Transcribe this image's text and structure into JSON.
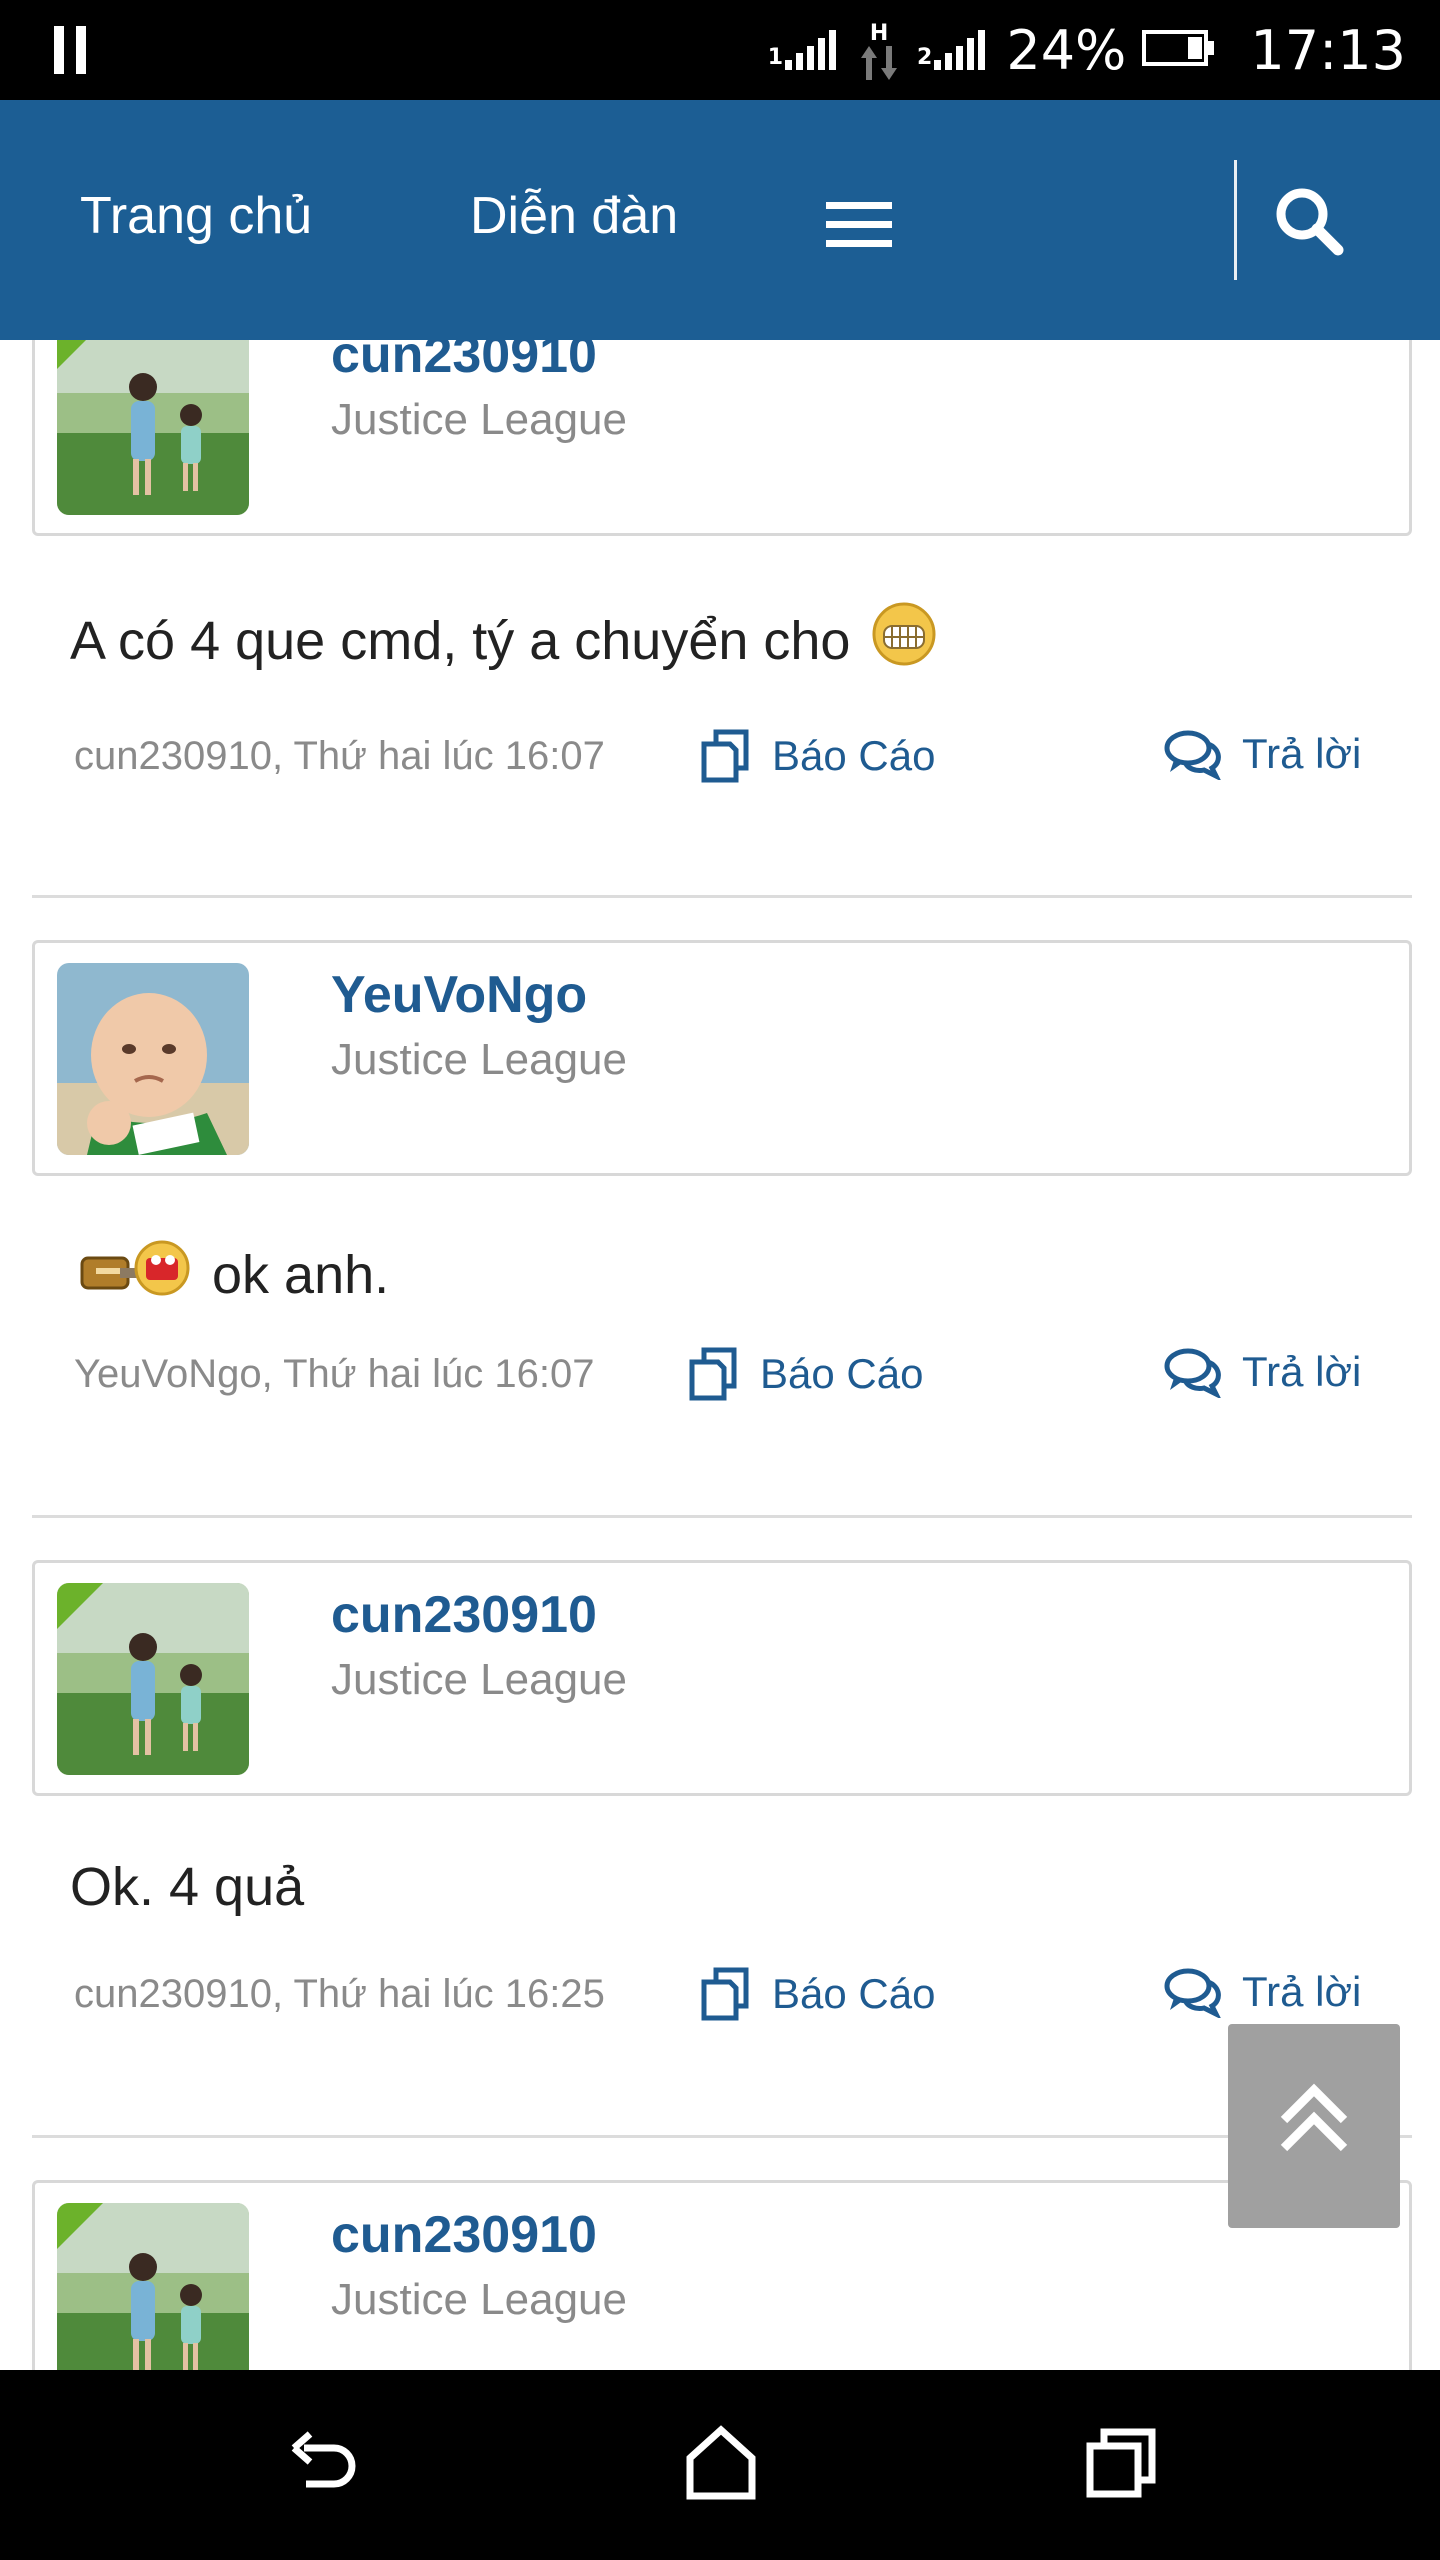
{
  "status_bar": {
    "signal1": "1",
    "network_type": "H",
    "signal2": "2",
    "battery_percent": "24%",
    "time": "17:13",
    "icons": [
      "pause-icon",
      "signal-icon",
      "network-h-icon",
      "signal-icon",
      "battery-icon"
    ]
  },
  "nav": {
    "home_label": "Trang chủ",
    "forum_label": "Diễn đàn",
    "icons": [
      "menu-icon",
      "search-icon"
    ]
  },
  "posts": [
    {
      "username": "cun230910",
      "user_title": "Justice League",
      "message": "A có 4 que cmd, tý a chuyển cho",
      "emoticon": "grin-emoticon",
      "meta": "cun230910, Thứ hai lúc 16:07",
      "report_label": "Báo Cáo",
      "reply_label": "Trả lời",
      "online": true
    },
    {
      "username": "YeuVoNgo",
      "user_title": "Justice League",
      "message": "ok anh.",
      "emoticon": "hammer-emoticon",
      "meta": "YeuVoNgo, Thứ hai lúc 16:07",
      "report_label": "Báo Cáo",
      "reply_label": "Trả lời",
      "online": false
    },
    {
      "username": "cun230910",
      "user_title": "Justice League",
      "message": "Ok. 4 quả",
      "meta": "cun230910, Thứ hai lúc 16:25",
      "report_label": "Báo Cáo",
      "reply_label": "Trả lời",
      "online": true
    },
    {
      "username": "cun230910",
      "user_title": "Justice League",
      "online": true
    }
  ],
  "colors": {
    "header_blue": "#1c5e94",
    "link_blue": "#1f5b91",
    "online_green": "#6cb22b",
    "meta_gray": "#8a8a8a"
  },
  "bottom_nav": {
    "icons": [
      "back-icon",
      "home-icon",
      "recents-icon"
    ]
  }
}
